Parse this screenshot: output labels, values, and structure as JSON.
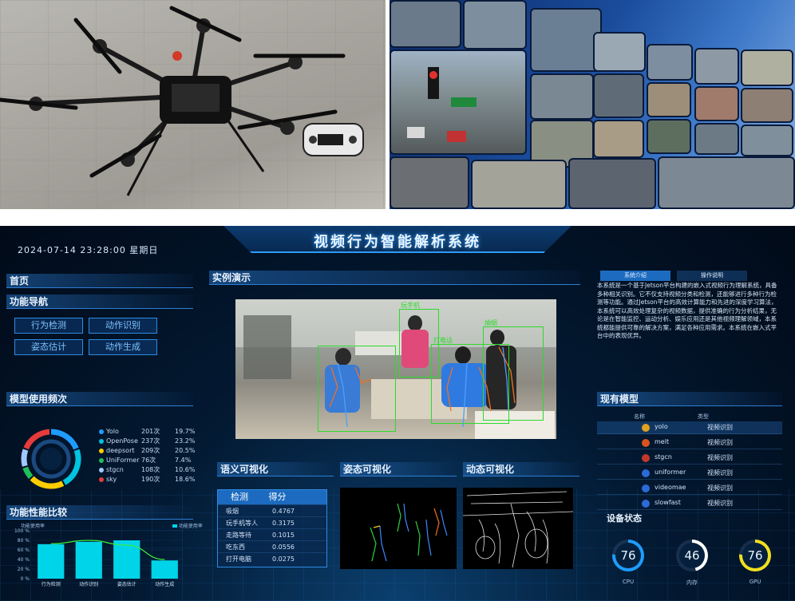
{
  "dashboard": {
    "title": "视频行为智能解析系统",
    "datetime": "2024-07-14  23:28:00  星期日"
  },
  "nav": {
    "home": "首页",
    "function_nav": "功能导航",
    "buttons": [
      "行为检测",
      "动作识别",
      "姿态估计",
      "动作生成"
    ]
  },
  "model_usage": {
    "title": "模型使用频次",
    "items": [
      {
        "name": "Yolo",
        "count": "201次",
        "pct": "19.7%",
        "color": "#1f9cff"
      },
      {
        "name": "OpenPose",
        "count": "237次",
        "pct": "23.2%",
        "color": "#00c4e0"
      },
      {
        "name": "deepsort",
        "count": "209次",
        "pct": "20.5%",
        "color": "#ffcc00"
      },
      {
        "name": "UniFormer",
        "count": "76次",
        "pct": "7.4%",
        "color": "#1fbf5a"
      },
      {
        "name": "stgcn",
        "count": "108次",
        "pct": "10.6%",
        "color": "#a0c8ff"
      },
      {
        "name": "sky",
        "count": "190次",
        "pct": "18.6%",
        "color": "#e63b3b"
      }
    ]
  },
  "func_compare": {
    "title": "功能性能比较",
    "ylabel": "功能使用率",
    "legend": "功能使用率"
  },
  "chart_data": {
    "type": "bar",
    "categories": [
      "行为检测",
      "动作识别",
      "姿态估计",
      "动作生成"
    ],
    "values": [
      72,
      77,
      80,
      38
    ],
    "ylim": [
      0,
      100
    ],
    "yticks": [
      "100 %",
      "80 %",
      "60 %",
      "40 %",
      "20 %",
      "0 %"
    ],
    "series": [
      {
        "name": "功能使用率",
        "values": [
          72,
          77,
          80,
          38
        ]
      }
    ],
    "line_values": [
      73,
      80,
      70,
      40
    ],
    "bar_color": "#00d4e8",
    "line_color": "#3bf03b"
  },
  "demo": {
    "title": "实例演示",
    "labels": [
      "玩手机",
      "打电话",
      "抽烟"
    ]
  },
  "semantic_viz": {
    "title": "语义可视化",
    "col_detect": "检测",
    "col_score": "得分",
    "rows": [
      {
        "label": "吸烟",
        "score": "0.4767"
      },
      {
        "label": "玩手机等人",
        "score": "0.3175"
      },
      {
        "label": "走路等待",
        "score": "0.1015"
      },
      {
        "label": "吃东西",
        "score": "0.0556"
      },
      {
        "label": "打开电脑",
        "score": "0.0275"
      }
    ]
  },
  "pose_viz": {
    "title": "姿态可视化"
  },
  "motion_viz": {
    "title": "动态可视化"
  },
  "intro": {
    "tabs": [
      "系统介绍",
      "操作说明"
    ],
    "text": "本系统是一个基于Jetson平台构建的嵌入式视频行为理解系统，具备多种相关识别。它不仅支持视频分类和检测，还能够进行多种行为检测等功能。通过Jetson平台的高效计算能力和先进的深度学习算法，本系统可以高效处理复杂的视频数据，提供准确的行为分析结果，无论是在智能监控、运动分析、娱乐应用还是其他视频理解领域，本系统都能提供可靠的解决方案，满足各种应用需求。本系统在嵌入式平台中的表现优异。"
  },
  "models": {
    "title": "现有模型",
    "col_name": "名称",
    "col_type": "类型",
    "rows": [
      {
        "name": "yolo",
        "type": "视频识别",
        "color": "#e0a020"
      },
      {
        "name": "melt",
        "type": "视频识别",
        "color": "#d9531e"
      },
      {
        "name": "stgcn",
        "type": "视频识别",
        "color": "#c0392b"
      },
      {
        "name": "uniformer",
        "type": "视频识别",
        "color": "#2b6ad8"
      },
      {
        "name": "videomae",
        "type": "视频识别",
        "color": "#2b6ad8"
      },
      {
        "name": "slowfast",
        "type": "视频识别",
        "color": "#2b6ad8"
      }
    ]
  },
  "device": {
    "title": "设备状态",
    "gauges": [
      {
        "value": "76",
        "label": "CPU",
        "color": "#1f9cff",
        "level": 0.76
      },
      {
        "value": "46",
        "label": "内存",
        "color": "#ffffff",
        "level": 0.46
      },
      {
        "value": "76",
        "label": "GPU",
        "color": "#f0e020",
        "level": 0.76
      }
    ]
  }
}
